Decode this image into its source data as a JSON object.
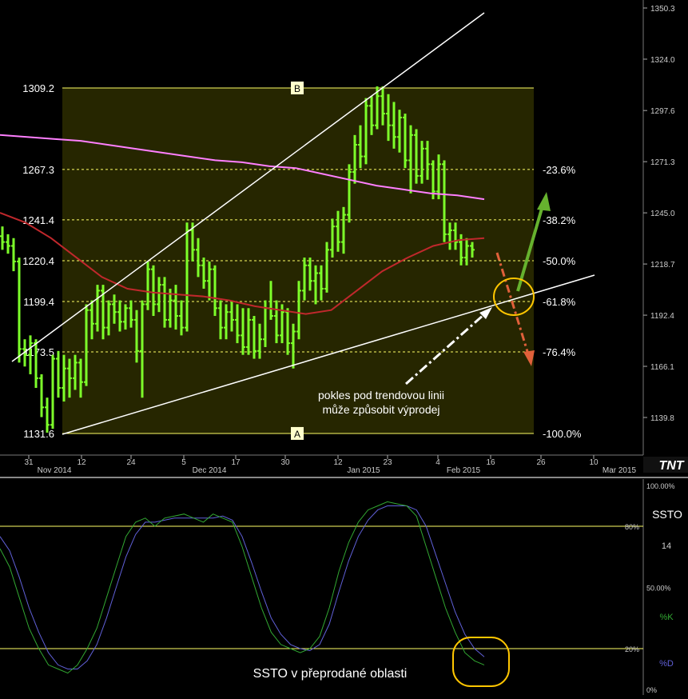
{
  "chart_data": [
    {
      "type": "bar",
      "subtype": "ohlc",
      "ylim": [
        1120,
        1355
      ],
      "xlabel": "",
      "ylabel": "",
      "y_axis_ticks": [
        "1350.3",
        "1324.0",
        "1297.6",
        "1271.3",
        "1245.0",
        "1218.7",
        "1192.4",
        "1166.1",
        "1139.8"
      ],
      "x_axis_ticks": [
        {
          "label": "31",
          "month": "Nov 2014"
        },
        {
          "label": "12",
          "month": ""
        },
        {
          "label": "24",
          "month": ""
        },
        {
          "label": "5",
          "month": "Dec 2014"
        },
        {
          "label": "17",
          "month": ""
        },
        {
          "label": "30",
          "month": ""
        },
        {
          "label": "12",
          "month": "Jan 2015"
        },
        {
          "label": "23",
          "month": ""
        },
        {
          "label": "4",
          "month": "Feb 2015"
        },
        {
          "label": "16",
          "month": ""
        },
        {
          "label": "26",
          "month": ""
        },
        {
          "label": "10",
          "month": "Mar 2015"
        }
      ],
      "fib_levels": [
        {
          "price": "1309.2",
          "pct": "",
          "tag": "B"
        },
        {
          "price": "1267.3",
          "pct": "-23.6%",
          "tag": ""
        },
        {
          "price": "1241.4",
          "pct": "-38.2%",
          "tag": ""
        },
        {
          "price": "1220.4",
          "pct": "-50.0%",
          "tag": ""
        },
        {
          "price": "1199.4",
          "pct": "-61.8%",
          "tag": ""
        },
        {
          "price": "1173.5",
          "pct": "-76.4%",
          "tag": ""
        },
        {
          "price": "1131.6",
          "pct": "-100.0%",
          "tag": "A"
        }
      ],
      "series": [
        {
          "values": [
            [
              1233,
              1238,
              1226,
              1230
            ],
            [
              1230,
              1234,
              1224,
              1228
            ],
            [
              1228,
              1232,
              1215,
              1220
            ],
            [
              1220,
              1222,
              1168,
              1175
            ],
            [
              1175,
              1180,
              1166,
              1172
            ],
            [
              1172,
              1182,
              1162,
              1178
            ],
            [
              1178,
              1180,
              1155,
              1160
            ],
            [
              1160,
              1162,
              1140,
              1145
            ],
            [
              1145,
              1150,
              1132,
              1136
            ],
            [
              1136,
              1172,
              1134,
              1170
            ],
            [
              1170,
              1174,
              1150,
              1155
            ],
            [
              1155,
              1172,
              1148,
              1165
            ],
            [
              1165,
              1170,
              1150,
              1160
            ],
            [
              1160,
              1172,
              1154,
              1168
            ],
            [
              1168,
              1170,
              1150,
              1158
            ],
            [
              1158,
              1198,
              1156,
              1195
            ],
            [
              1195,
              1200,
              1180,
              1188
            ],
            [
              1188,
              1208,
              1184,
              1205
            ],
            [
              1205,
              1208,
              1180,
              1186
            ],
            [
              1186,
              1200,
              1182,
              1198
            ],
            [
              1198,
              1203,
              1188,
              1194
            ],
            [
              1194,
              1200,
              1184,
              1189
            ],
            [
              1189,
              1198,
              1185,
              1196
            ],
            [
              1196,
              1200,
              1186,
              1190
            ],
            [
              1190,
              1195,
              1168,
              1174
            ],
            [
              1174,
              1200,
              1150,
              1198
            ],
            [
              1198,
              1220,
              1195,
              1216
            ],
            [
              1216,
              1218,
              1192,
              1198
            ],
            [
              1198,
              1212,
              1194,
              1208
            ],
            [
              1208,
              1212,
              1186,
              1190
            ],
            [
              1190,
              1206,
              1186,
              1200
            ],
            [
              1200,
              1208,
              1185,
              1192
            ],
            [
              1192,
              1200,
              1182,
              1186
            ],
            [
              1186,
              1240,
              1184,
              1236
            ],
            [
              1236,
              1240,
              1220,
              1226
            ],
            [
              1226,
              1232,
              1212,
              1218
            ],
            [
              1218,
              1222,
              1206,
              1210
            ],
            [
              1210,
              1220,
              1200,
              1216
            ],
            [
              1216,
              1218,
              1192,
              1196
            ],
            [
              1196,
              1200,
              1180,
              1186
            ],
            [
              1186,
              1198,
              1180,
              1194
            ],
            [
              1194,
              1200,
              1184,
              1190
            ],
            [
              1190,
              1198,
              1178,
              1182
            ],
            [
              1182,
              1196,
              1172,
              1176
            ],
            [
              1176,
              1196,
              1172,
              1190
            ],
            [
              1190,
              1192,
              1170,
              1174
            ],
            [
              1174,
              1188,
              1170,
              1180
            ],
            [
              1180,
              1200,
              1176,
              1196
            ],
            [
              1196,
              1210,
              1190,
              1192
            ],
            [
              1192,
              1200,
              1178,
              1182
            ],
            [
              1182,
              1198,
              1178,
              1194
            ],
            [
              1194,
              1196,
              1172,
              1178
            ],
            [
              1178,
              1188,
              1165,
              1184
            ],
            [
              1184,
              1210,
              1180,
              1205
            ],
            [
              1205,
              1222,
              1200,
              1218
            ],
            [
              1218,
              1222,
              1205,
              1210
            ],
            [
              1210,
              1218,
              1198,
              1214
            ],
            [
              1214,
              1218,
              1200,
              1206
            ],
            [
              1206,
              1230,
              1204,
              1226
            ],
            [
              1226,
              1242,
              1222,
              1238
            ],
            [
              1238,
              1246,
              1225,
              1230
            ],
            [
              1230,
              1248,
              1224,
              1244
            ],
            [
              1244,
              1270,
              1240,
              1266
            ],
            [
              1266,
              1285,
              1260,
              1280
            ],
            [
              1280,
              1290,
              1268,
              1274
            ],
            [
              1274,
              1304,
              1270,
              1300
            ],
            [
              1300,
              1305,
              1285,
              1290
            ],
            [
              1290,
              1310,
              1288,
              1305
            ],
            [
              1305,
              1310,
              1290,
              1296
            ],
            [
              1296,
              1306,
              1282,
              1290
            ],
            [
              1290,
              1302,
              1278,
              1284
            ],
            [
              1284,
              1298,
              1276,
              1294
            ],
            [
              1294,
              1296,
              1268,
              1272
            ],
            [
              1272,
              1290,
              1255,
              1285
            ],
            [
              1285,
              1288,
              1260,
              1264
            ],
            [
              1264,
              1282,
              1260,
              1278
            ],
            [
              1278,
              1282,
              1262,
              1270
            ],
            [
              1270,
              1272,
              1252,
              1256
            ],
            [
              1256,
              1275,
              1252,
              1270
            ],
            [
              1270,
              1272,
              1230,
              1234
            ],
            [
              1234,
              1240,
              1226,
              1236
            ],
            [
              1236,
              1240,
              1226,
              1230
            ],
            [
              1230,
              1234,
              1218,
              1222
            ],
            [
              1222,
              1232,
              1218,
              1228
            ],
            [
              1228,
              1230,
              1222,
              1226
            ]
          ]
        },
        {
          "name": "",
          "role": "moving-average-magenta",
          "values": [
            1285,
            1284,
            1283,
            1282,
            1280,
            1278,
            1276,
            1274,
            1272,
            1271,
            1269,
            1268,
            1265,
            1262,
            1259,
            1257,
            1255,
            1254,
            1252
          ]
        },
        {
          "name": "",
          "role": "moving-average-red",
          "values": [
            1245,
            1240,
            1232,
            1222,
            1212,
            1206,
            1204,
            1203,
            1202,
            1200,
            1197,
            1195,
            1193,
            1195,
            1205,
            1215,
            1222,
            1228,
            1231,
            1232
          ]
        }
      ],
      "annotations": [
        "pokles pod trendovou linii",
        "může způsobit výprodej"
      ],
      "colors": {
        "bars": "#7dff2a",
        "magenta_ma": "#ff7fff",
        "red_ma": "#c0282c",
        "fib": "#ffff66",
        "box_fill": "#262600",
        "green_arrow": "#66b22e",
        "red_arrow": "#e0603a",
        "circle": "#ffc600"
      }
    },
    {
      "type": "line",
      "title": "SSTO",
      "parameter": "14",
      "ylim": [
        0,
        100
      ],
      "y_axis_ticks": [
        "100.00%",
        "80%",
        "50.00%",
        "20%",
        "0%"
      ],
      "series": [
        {
          "name": "%K",
          "values": [
            69,
            60,
            45,
            30,
            20,
            12,
            10,
            8,
            12,
            20,
            30,
            45,
            60,
            75,
            82,
            84,
            80,
            84,
            85,
            86,
            84,
            82,
            86,
            84,
            82,
            70,
            55,
            40,
            28,
            22,
            20,
            18,
            20,
            26,
            40,
            58,
            72,
            82,
            88,
            90,
            92,
            91,
            90,
            85,
            70,
            55,
            40,
            28,
            18,
            14,
            12
          ]
        },
        {
          "name": "%D",
          "values": [
            75,
            68,
            55,
            40,
            28,
            18,
            12,
            10,
            10,
            14,
            22,
            35,
            50,
            65,
            76,
            82,
            82,
            83,
            84,
            84,
            84,
            84,
            84,
            85,
            83,
            75,
            62,
            48,
            35,
            27,
            22,
            20,
            19,
            22,
            32,
            48,
            63,
            75,
            83,
            88,
            90,
            90,
            90,
            88,
            80,
            66,
            52,
            38,
            27,
            20,
            16
          ]
        }
      ],
      "annotation": "SSTO v přeprodané oblasti",
      "colors": {
        "k": "#32a832",
        "d": "#6060d8",
        "guide": "#ffff66"
      }
    }
  ],
  "labels": {
    "logo": "TNT",
    "k_label": "%K",
    "d_label": "%D",
    "ind_title": "SSTO",
    "ind_param": "14"
  }
}
